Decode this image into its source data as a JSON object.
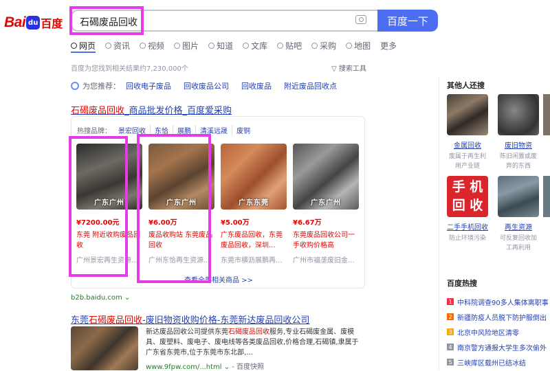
{
  "logo": {
    "bai": "Bai",
    "paw": "du",
    "du": "百度"
  },
  "search": {
    "query": "石碣废品回收",
    "button": "百度一下"
  },
  "tabs": [
    "网页",
    "资讯",
    "视频",
    "图片",
    "知道",
    "文库",
    "贴吧",
    "采购",
    "地图",
    "更多"
  ],
  "result_count": "百度为您找到相关结果约7,230,000个",
  "tools": "搜索工具",
  "recommend": {
    "label": "为您推荐：",
    "items": [
      "回收电子废品",
      "回收废品公司",
      "回收废品",
      "附近废品回收点"
    ]
  },
  "ad": {
    "title_red": "石碣废品回收",
    "title_rest": "_商品批发价格_百度爱采购",
    "hot_label": "热搜品牌：",
    "brands": [
      "景宏回收",
      "东恰",
      "展鹏",
      "清溪远晟",
      "废铜"
    ],
    "products": [
      {
        "loc": "广东广州",
        "price": "¥7200.00元",
        "name": "东莞 附近收购废品回收",
        "shop": "广州景宏再生资源..."
      },
      {
        "loc": "广东广州",
        "price": "¥6.00万",
        "name": "废品收购站 东莞废品回收",
        "shop": "广州东恰再生资源..."
      },
      {
        "loc": "广东东莞",
        "price": "¥5.00万",
        "name": "广东废品回收，东莞废品回收，深圳...",
        "shop": "东莞市横沥展鹏再..."
      },
      {
        "loc": "广东广州",
        "price": "¥6.67万",
        "name": "东莞废品回收公司一手收购价格高",
        "shop": "广州市福垄废旧金..."
      }
    ],
    "more_goods": "查看全部相关商品 >>",
    "source": "b2b.baidu.com"
  },
  "result2": {
    "title_pre": "东莞",
    "title_red": "石碣废品回收",
    "title_rest": "-废旧物资收购价格-东莞新达废品回收公司",
    "desc_pre": "新达废品回收公司提供东莞",
    "desc_red": "石碣废品回收",
    "desc_rest": "服务,专业石碣废金属、废模具、废塑料、废电子、废电线等各类废品回收,价格合理,石碣镇,隶属于广东省东莞市,位于东莞市东北部,...",
    "url": "www.9fpw.com/...html",
    "snapshot": "- 百度快照"
  },
  "sidebar": {
    "others_title": "其他人还搜",
    "related": [
      {
        "name": "金属回收",
        "desc": "废属于再生利用产业链"
      },
      {
        "name": "废旧物资",
        "desc": "陈旧闲置或废弃的东西"
      },
      {
        "name": "二手手机回收",
        "desc": "防止环境污染"
      },
      {
        "name": "再生资源",
        "desc": "可反复回收加工再利用"
      }
    ],
    "hot_title": "百度热搜",
    "hot": [
      {
        "num": "1",
        "text": "中科院调查90多人集体离职事"
      },
      {
        "num": "2",
        "text": "新疆防疫人员脱下防护服倒出"
      },
      {
        "num": "3",
        "text": "北京中风险地区清零"
      },
      {
        "num": "4",
        "text": "南京警方通报大学生多次偷外"
      },
      {
        "num": "5",
        "text": "三峡库区载州已结冰结"
      }
    ]
  },
  "colors": {
    "brand_red": "#e10601",
    "button_blue": "#4e6ef2",
    "link": "#2440b3",
    "green_url": "#237c27",
    "annotation_box": "#e63ce8"
  }
}
